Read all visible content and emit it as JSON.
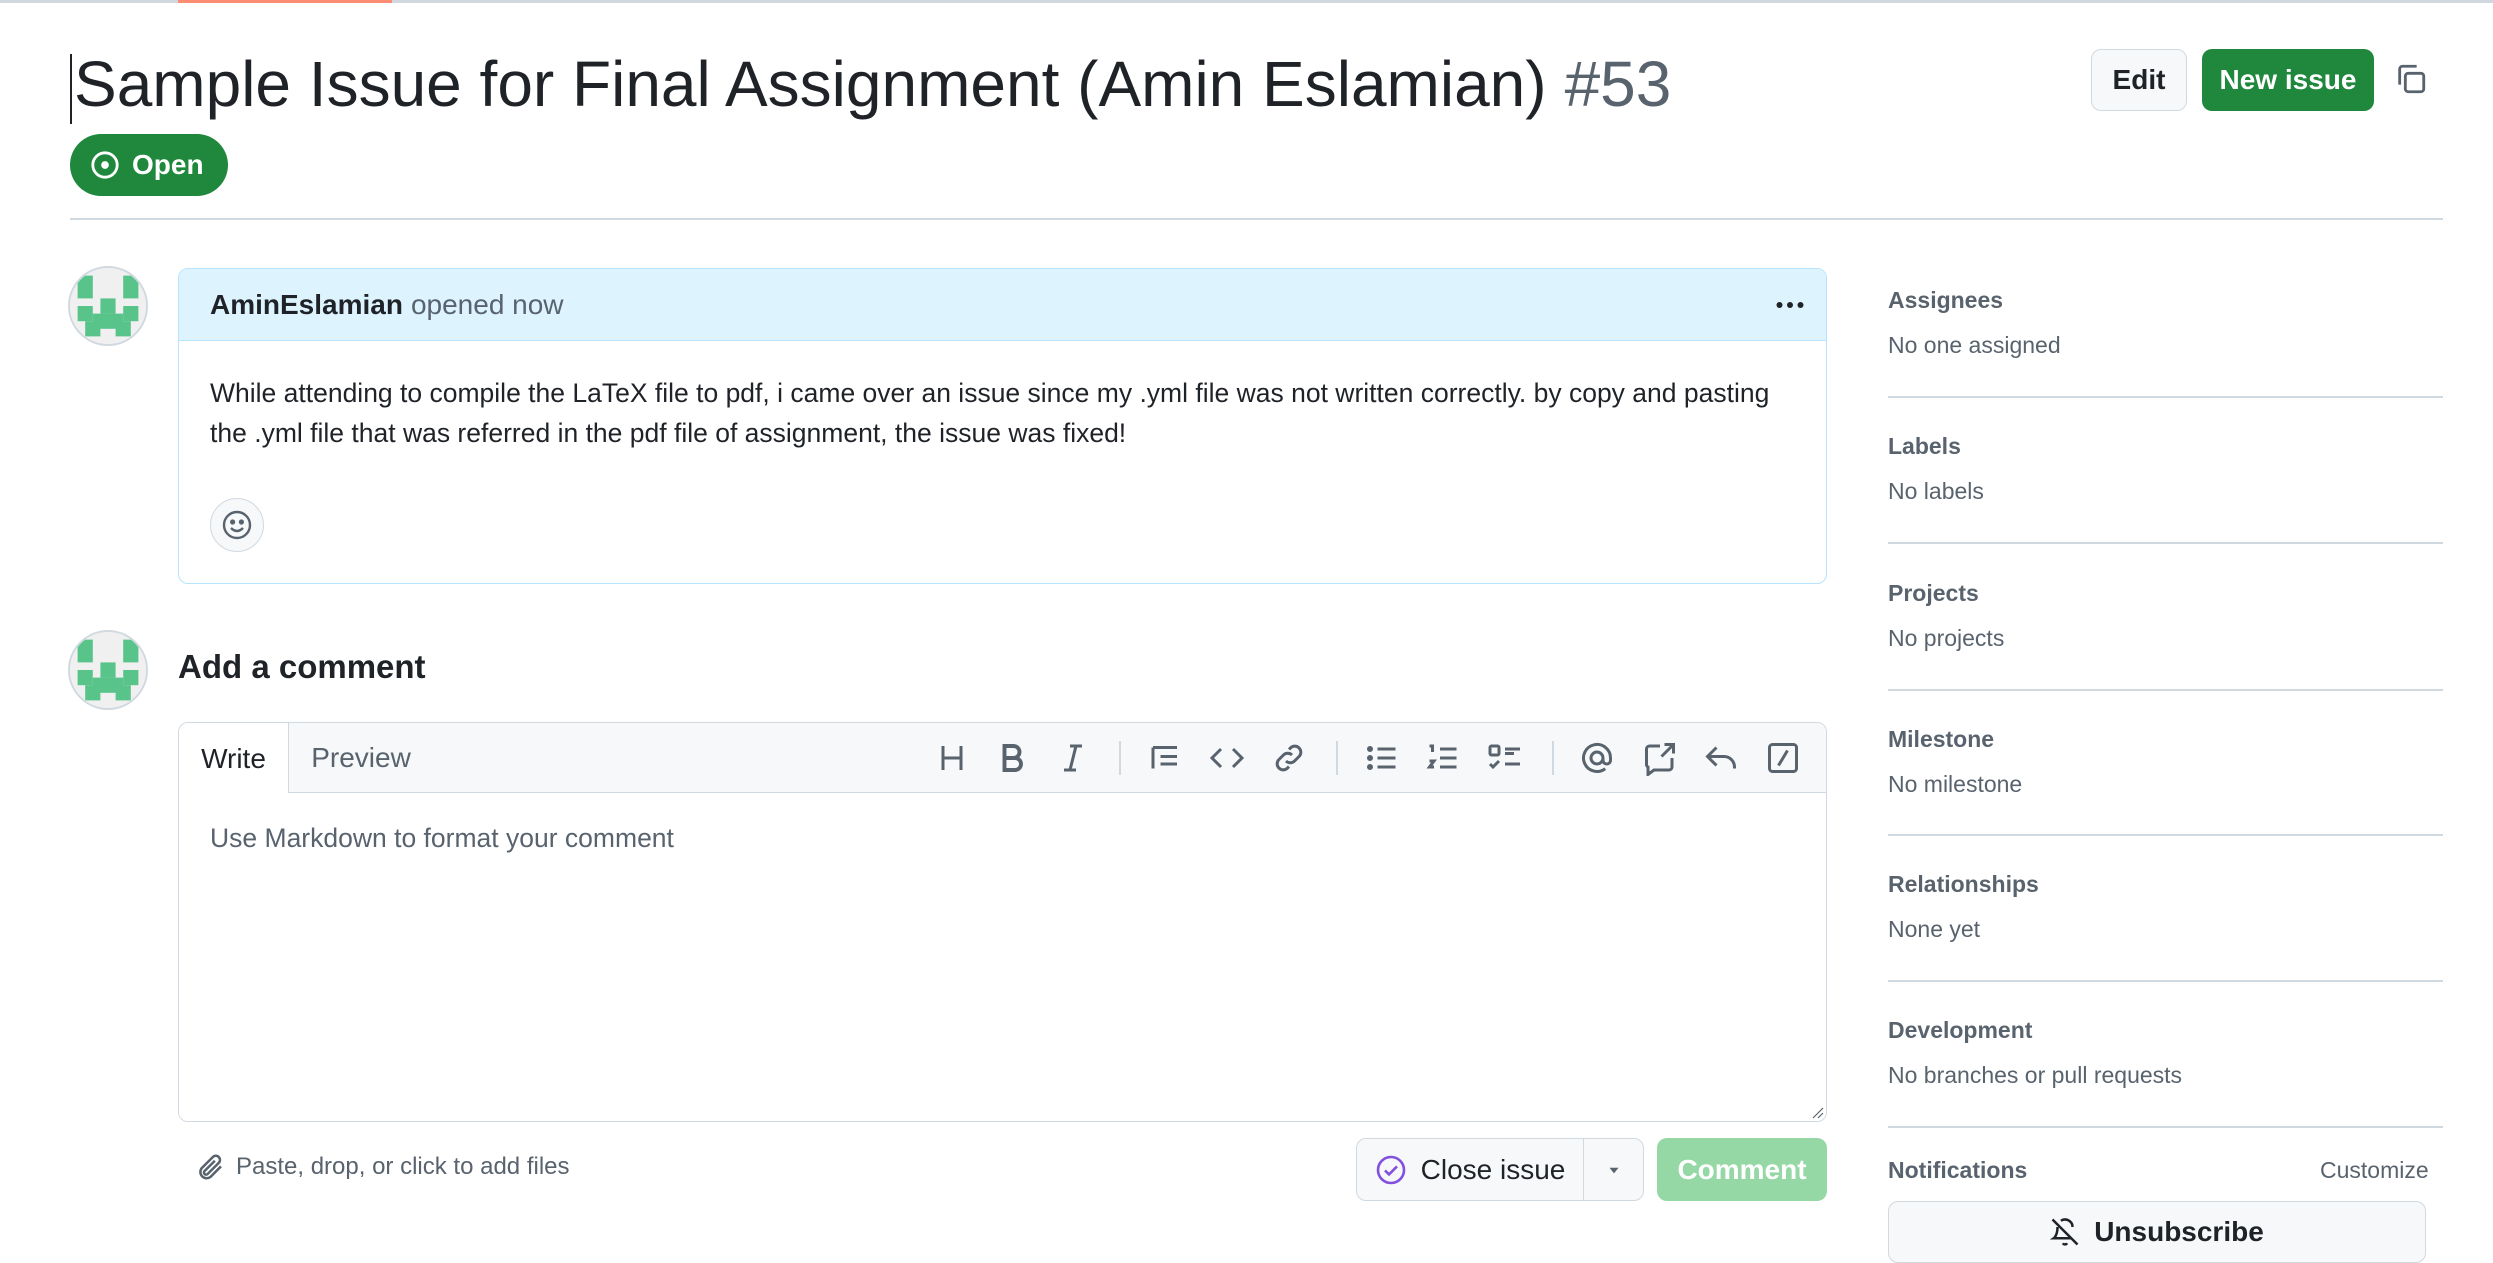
{
  "issue": {
    "title": "Sample Issue for Final Assignment (Amin Eslamian)",
    "number": "#53",
    "state": "Open"
  },
  "header": {
    "edit_label": "Edit",
    "new_issue_label": "New issue"
  },
  "comment": {
    "author": "AminEslamian",
    "meta": "opened now",
    "body": "While attending to compile the LaTeX file to pdf, i came over an issue since my .yml file was not written correctly. by copy and pasting the .yml file that was referred in the pdf file of assignment, the issue was fixed!"
  },
  "composer": {
    "title": "Add a comment",
    "tab_write": "Write",
    "tab_preview": "Preview",
    "placeholder": "Use Markdown to format your comment",
    "attach_text": "Paste, drop, or click to add files",
    "close_issue_label": "Close issue",
    "comment_label": "Comment"
  },
  "sidebar": {
    "sections": [
      {
        "label": "Assignees",
        "value": "No one assigned"
      },
      {
        "label": "Labels",
        "value": "No labels"
      },
      {
        "label": "Projects",
        "value": "No projects"
      },
      {
        "label": "Milestone",
        "value": "No milestone"
      },
      {
        "label": "Relationships",
        "value": "None yet"
      },
      {
        "label": "Development",
        "value": "No branches or pull requests"
      }
    ],
    "notifications_label": "Notifications",
    "customize_label": "Customize",
    "unsubscribe_label": "Unsubscribe"
  },
  "colors": {
    "primary_green": "#1f883d",
    "disabled_green": "#95d8a6",
    "comment_header_bg": "#ddf4ff",
    "close_issue_icon": "#8250df"
  },
  "icons": [
    "issue-opened-icon",
    "copy-icon",
    "kebab-horizontal-icon",
    "smiley-icon",
    "heading-icon",
    "bold-icon",
    "italic-icon",
    "quote-icon",
    "code-icon",
    "link-icon",
    "unordered-list-icon",
    "ordered-list-icon",
    "tasklist-icon",
    "mention-icon",
    "cross-reference-icon",
    "reply-icon",
    "slash-command-icon",
    "paperclip-icon",
    "check-circle-icon",
    "triangle-down-icon",
    "bell-slash-icon"
  ]
}
